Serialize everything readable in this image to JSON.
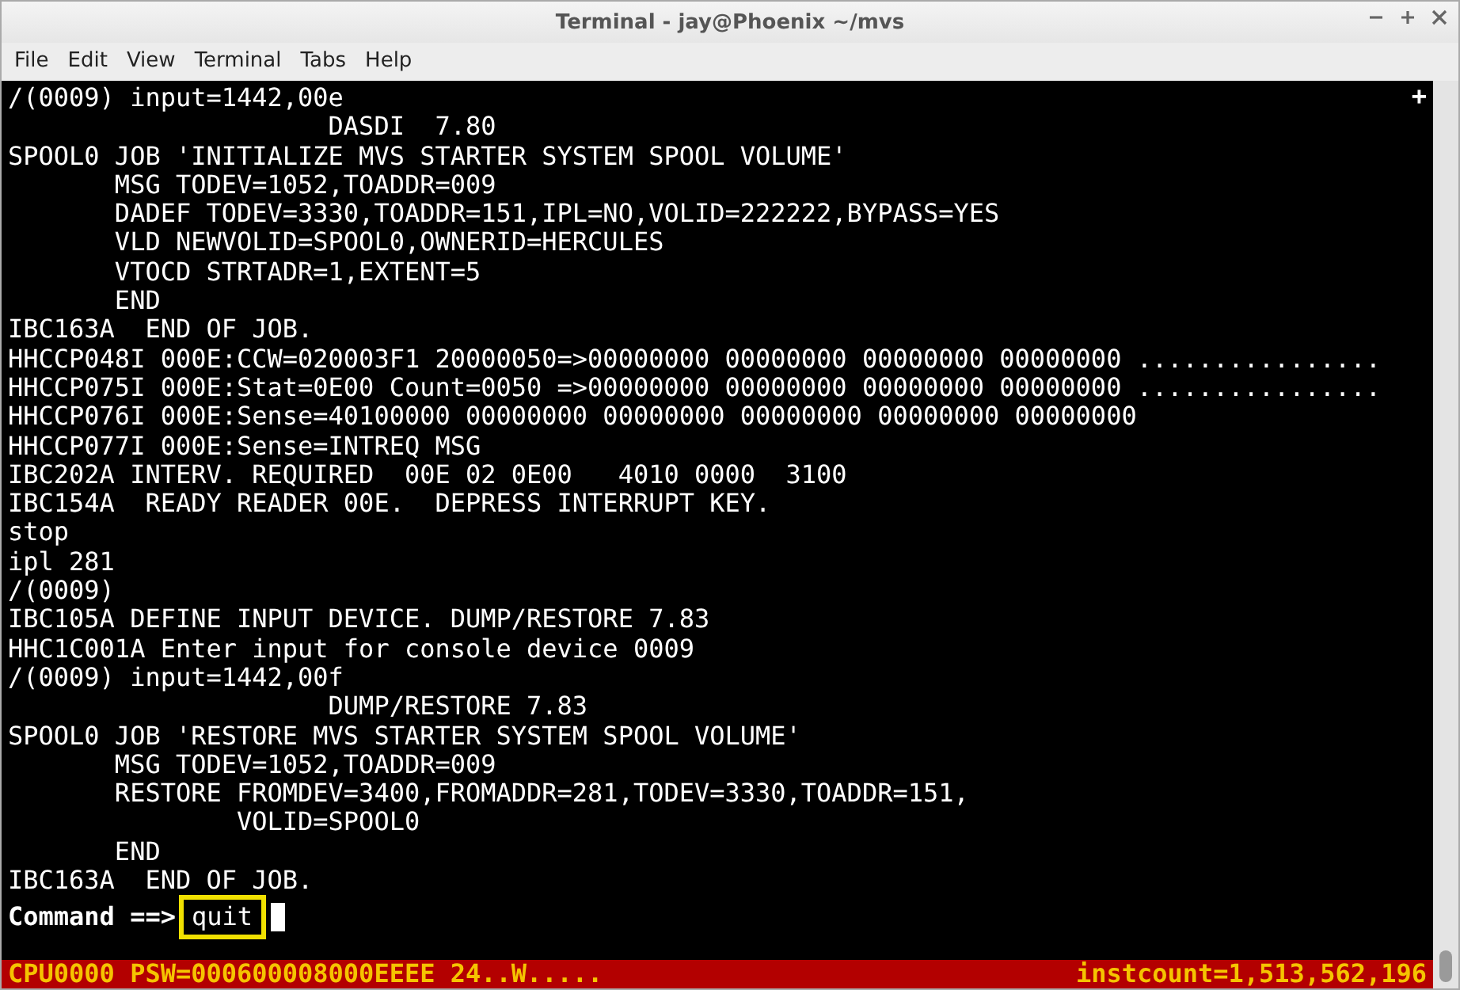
{
  "window": {
    "title": "Terminal - jay@Phoenix ~/mvs"
  },
  "menu": [
    "File",
    "Edit",
    "View",
    "Terminal",
    "Tabs",
    "Help"
  ],
  "terminal": {
    "marker": "+",
    "lines": [
      "/(0009) input=1442,00e",
      "                     DASDI  7.80",
      "SPOOL0 JOB 'INITIALIZE MVS STARTER SYSTEM SPOOL VOLUME'",
      "       MSG TODEV=1052,TOADDR=009",
      "       DADEF TODEV=3330,TOADDR=151,IPL=NO,VOLID=222222,BYPASS=YES",
      "       VLD NEWVOLID=SPOOL0,OWNERID=HERCULES",
      "       VTOCD STRTADR=1,EXTENT=5",
      "       END",
      "IBC163A  END OF JOB.",
      "HHCCP048I 000E:CCW=020003F1 20000050=>00000000 00000000 00000000 00000000 ................",
      "HHCCP075I 000E:Stat=0E00 Count=0050 =>00000000 00000000 00000000 00000000 ................",
      "HHCCP076I 000E:Sense=40100000 00000000 00000000 00000000 00000000 00000000",
      "HHCCP077I 000E:Sense=INTREQ MSG",
      "IBC202A INTERV. REQUIRED  00E 02 0E00   4010 0000  3100",
      "IBC154A  READY READER 00E.  DEPRESS INTERRUPT KEY.",
      "stop",
      "ipl 281",
      "/(0009)",
      "IBC105A DEFINE INPUT DEVICE. DUMP/RESTORE 7.83",
      "HHC1C001A Enter input for console device 0009",
      "/(0009) input=1442,00f",
      "                     DUMP/RESTORE 7.83",
      "SPOOL0 JOB 'RESTORE MVS STARTER SYSTEM SPOOL VOLUME'",
      "       MSG TODEV=1052,TOADDR=009",
      "       RESTORE FROMDEV=3400,FROMADDR=281,TODEV=3330,TOADDR=151,",
      "               VOLID=SPOOL0",
      "       END",
      "IBC163A  END OF JOB."
    ],
    "command": {
      "prompt": "Command ==>",
      "value": "quit",
      "highlighted": true
    },
    "status": {
      "left": "CPU0000 PSW=000600008000EEEE 24..W.....",
      "right": "instcount=1,513,562,196"
    }
  }
}
